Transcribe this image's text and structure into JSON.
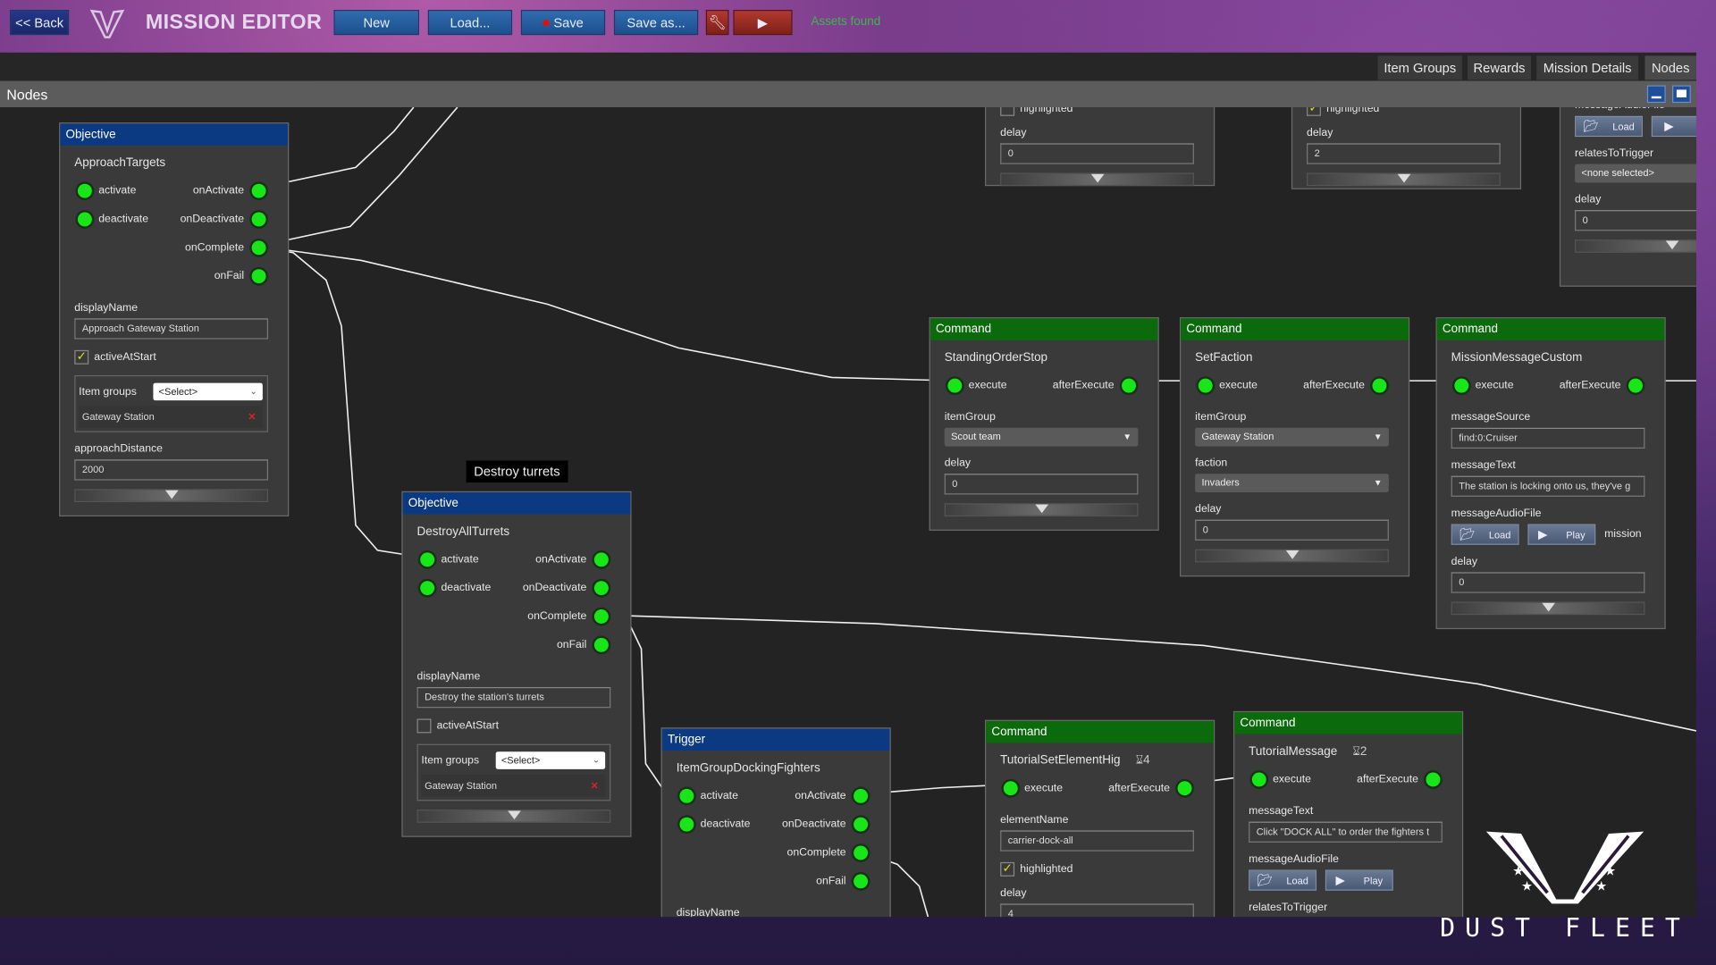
{
  "topbar": {
    "back": "<< Back",
    "title": "MISSION EDITOR",
    "new": "New",
    "load": "Load...",
    "save": "Save",
    "save_as": "Save as...",
    "wrench_icon": "wrench-icon",
    "play_icon": "play-icon",
    "status": "Assets found",
    "save_dot_color": "#e01010",
    "status_color": "#3bb84a"
  },
  "tabs": [
    "Item Groups",
    "Rewards",
    "Mission Details",
    "Nodes"
  ],
  "panel": {
    "title": "Nodes"
  },
  "tooltip": "Destroy turrets",
  "colors": {
    "objective_header": "#0b3a82",
    "command_header": "#0b6a0b",
    "port": "#19e619",
    "canvas": "#232323"
  },
  "nodes": [
    {
      "id": "top1",
      "fields": [
        {
          "type": "check",
          "label": "highlighted",
          "checked": false
        },
        {
          "type": "input",
          "label": "delay",
          "value": "0"
        },
        {
          "type": "expander"
        }
      ]
    },
    {
      "id": "top2",
      "fields": [
        {
          "type": "check",
          "label": "highlighted",
          "checked": true
        },
        {
          "type": "input",
          "label": "delay",
          "value": "2"
        },
        {
          "type": "expander"
        }
      ]
    },
    {
      "id": "top3",
      "fields": [
        {
          "type": "audio",
          "label": "messageAudioFile",
          "load": "Load",
          "play": "Pl"
        },
        {
          "type": "select",
          "label": "relatesToTrigger",
          "value": "<none selected>"
        },
        {
          "type": "input",
          "label": "delay",
          "value": "0"
        },
        {
          "type": "expander"
        }
      ]
    },
    {
      "id": "obj1",
      "kind": "Objective",
      "name": "ApproachTargets",
      "ports": [
        [
          "activate",
          "onActivate"
        ],
        [
          "deactivate",
          "onDeactivate"
        ],
        [
          "",
          "onComplete"
        ],
        [
          "",
          "onFail"
        ]
      ],
      "fields": [
        {
          "type": "input",
          "label": "displayName",
          "value": "Approach Gateway Station"
        },
        {
          "type": "check",
          "label": "activeAtStart",
          "checked": true
        },
        {
          "type": "itemgroups",
          "label": "Item groups",
          "select": "<Select>",
          "item": "Gateway Station"
        },
        {
          "type": "input",
          "label": "approachDistance",
          "value": "2000"
        },
        {
          "type": "expander"
        }
      ]
    },
    {
      "id": "obj2",
      "kind": "Objective",
      "name": "DestroyAllTurrets",
      "ports": [
        [
          "activate",
          "onActivate"
        ],
        [
          "deactivate",
          "onDeactivate"
        ],
        [
          "",
          "onComplete"
        ],
        [
          "",
          "onFail"
        ]
      ],
      "fields": [
        {
          "type": "input",
          "label": "displayName",
          "value": "Destroy the station's turrets"
        },
        {
          "type": "check",
          "label": "activeAtStart",
          "checked": false
        },
        {
          "type": "itemgroups",
          "label": "Item groups",
          "select": "<Select>",
          "item": "Gateway Station"
        },
        {
          "type": "expander"
        }
      ]
    },
    {
      "id": "trig",
      "kind": "Trigger",
      "name": "ItemGroupDockingFighters",
      "ports": [
        [
          "activate",
          "onActivate"
        ],
        [
          "deactivate",
          "onDeactivate"
        ],
        [
          "",
          "onComplete"
        ],
        [
          "",
          "onFail"
        ]
      ],
      "fields": [
        {
          "type": "label",
          "label": "displayName"
        }
      ]
    },
    {
      "id": "cmd1",
      "kind": "Command",
      "name": "StandingOrderStop",
      "ports": [
        [
          "execute",
          "afterExecute"
        ]
      ],
      "fields": [
        {
          "type": "select",
          "label": "itemGroup",
          "value": "Scout team"
        },
        {
          "type": "input",
          "label": "delay",
          "value": "0"
        },
        {
          "type": "expander"
        }
      ]
    },
    {
      "id": "cmd2",
      "kind": "Command",
      "name": "SetFaction",
      "ports": [
        [
          "execute",
          "afterExecute"
        ]
      ],
      "fields": [
        {
          "type": "select",
          "label": "itemGroup",
          "value": "Gateway Station"
        },
        {
          "type": "select",
          "label": "faction",
          "value": "Invaders"
        },
        {
          "type": "input",
          "label": "delay",
          "value": "0"
        },
        {
          "type": "expander"
        }
      ]
    },
    {
      "id": "cmd3",
      "kind": "Command",
      "name": "MissionMessageCustom",
      "ports": [
        [
          "execute",
          "afterExecute"
        ]
      ],
      "fields": [
        {
          "type": "input",
          "label": "messageSource",
          "value": "find:0:Cruiser"
        },
        {
          "type": "input",
          "label": "messageText",
          "value": "The station is locking onto us, they've g"
        },
        {
          "type": "audio",
          "label": "messageAudioFile",
          "load": "Load",
          "play": "Play",
          "extra": "mission"
        },
        {
          "type": "input",
          "label": "delay",
          "value": "0"
        },
        {
          "type": "expander"
        }
      ]
    },
    {
      "id": "cmd4",
      "kind": "Command",
      "name": "TutorialSetElementHig",
      "hourglass": "4",
      "ports": [
        [
          "execute",
          "afterExecute"
        ]
      ],
      "fields": [
        {
          "type": "input",
          "label": "elementName",
          "value": "carrier-dock-all"
        },
        {
          "type": "check",
          "label": "highlighted",
          "checked": true
        },
        {
          "type": "input",
          "label": "delay",
          "value": "4"
        }
      ]
    },
    {
      "id": "cmd5",
      "kind": "Command",
      "name": "TutorialMessage",
      "hourglass": "2",
      "ports": [
        [
          "execute",
          "afterExecute"
        ]
      ],
      "fields": [
        {
          "type": "input",
          "label": "messageText",
          "value": "Click \"DOCK ALL\" to order the fighters t"
        },
        {
          "type": "audio",
          "label": "messageAudioFile",
          "load": "Load",
          "play": "Play"
        },
        {
          "type": "label",
          "label": "relatesToTrigger"
        }
      ]
    }
  ],
  "brand": {
    "wordmark": "DUST FLEET"
  }
}
